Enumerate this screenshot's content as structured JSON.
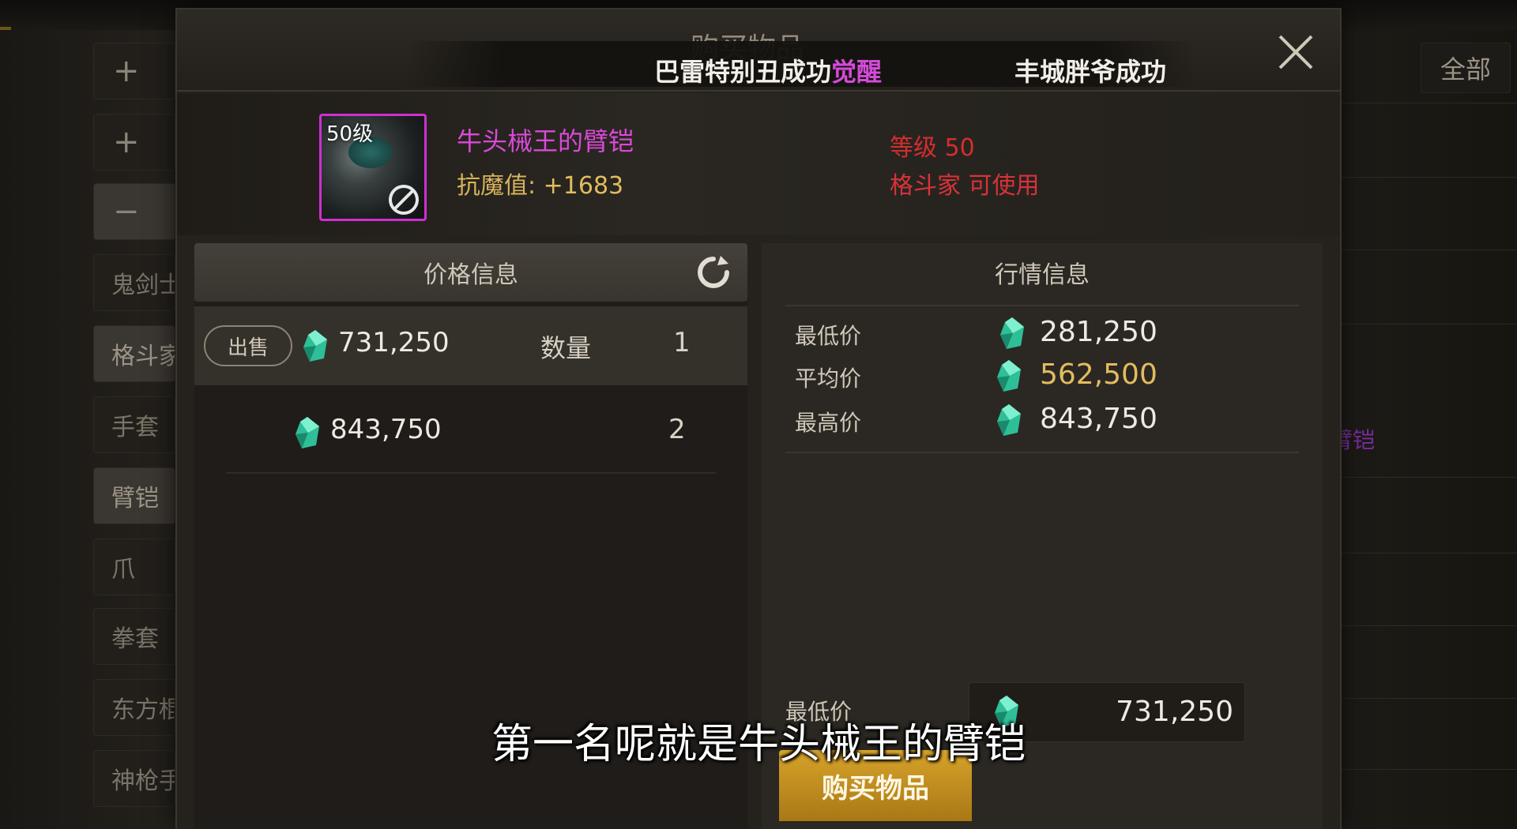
{
  "sidebar": {
    "plus1": "+",
    "plus2": "+",
    "minus": "−",
    "items": [
      "鬼剑士",
      "格斗家",
      "手套",
      "臂铠",
      "爪",
      "拳套",
      "东方棍",
      "神枪手"
    ]
  },
  "right_panel": {
    "all_button": "全部",
    "purple_text": "臂铠"
  },
  "dialog": {
    "title": "购买物品",
    "notice": {
      "part1": "巴雷特别丑成功",
      "part1_highlight": "觉醒",
      "part2": "丰城胖爷成功"
    }
  },
  "item": {
    "level_badge": "50级",
    "name": "牛头械王的臂铠",
    "stat_label": "抗魔值: ",
    "stat_value": "+1683",
    "required_level": "等级 50",
    "usable_class": "格斗家 可使用",
    "icon": "arm-armor-icon"
  },
  "price_info": {
    "title": "价格信息",
    "sell_tag": "出售",
    "qty_label": "数量",
    "rows": [
      {
        "price": "731,250",
        "qty": "1"
      },
      {
        "price": "843,750",
        "qty": "2"
      }
    ]
  },
  "market_info": {
    "title": "行情信息",
    "min_label": "最低价",
    "min_value": "281,250",
    "avg_label": "平均价",
    "avg_value": "562,500",
    "max_label": "最高价",
    "max_value": "843,750",
    "bottom_min_label": "最低价",
    "bottom_min_value": "731,250"
  },
  "buy_button": "购买物品",
  "subtitle": "第一名呢就是牛头械王的臂铠",
  "colors": {
    "gem": "#3ec8a6",
    "accent_gold": "#e2bc5e",
    "purple": "#d44bd8",
    "red": "#d32e2e",
    "buy": "#d7a32a"
  }
}
